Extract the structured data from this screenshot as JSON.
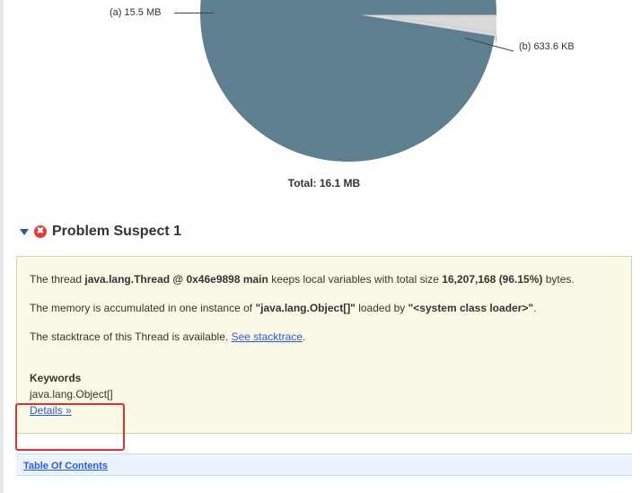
{
  "chart_data": {
    "type": "pie",
    "title": "Total: 16.1 MB",
    "series": [
      {
        "name": "(a)",
        "label": "15.5 MB",
        "value": 15.5,
        "unit": "MB",
        "color": "#5e7f8f"
      },
      {
        "name": "(b)",
        "label": "633.6 KB",
        "value": 0.6187,
        "unit": "MB",
        "color": "#d9d9d9"
      }
    ]
  },
  "labels": {
    "a": "(a) 15.5 MB",
    "b": "(b) 633.6 KB",
    "total": "Total: 16.1 MB"
  },
  "section": {
    "title": "Problem Suspect 1"
  },
  "suspect": {
    "p1_pre": "The thread ",
    "p1_bold1": "java.lang.Thread @ 0x46e9898 main",
    "p1_mid": " keeps local variables with total size ",
    "p1_bold2": "16,207,168 (96.15%)",
    "p1_post": " bytes.",
    "p2_pre": "The memory is accumulated in one instance of ",
    "p2_bold1": "\"java.lang.Object[]\"",
    "p2_mid": " loaded by ",
    "p2_bold2": "\"<system class loader>\"",
    "p2_post": ".",
    "p3_pre": "The stacktrace of this Thread is available. ",
    "stacktrace_link": "See stacktrace",
    "p3_post": ".",
    "keywords_label": "Keywords",
    "keyword_value": "java.lang.Object[]",
    "details_link": "Details »"
  },
  "footer": {
    "toc": "Table Of Contents"
  }
}
